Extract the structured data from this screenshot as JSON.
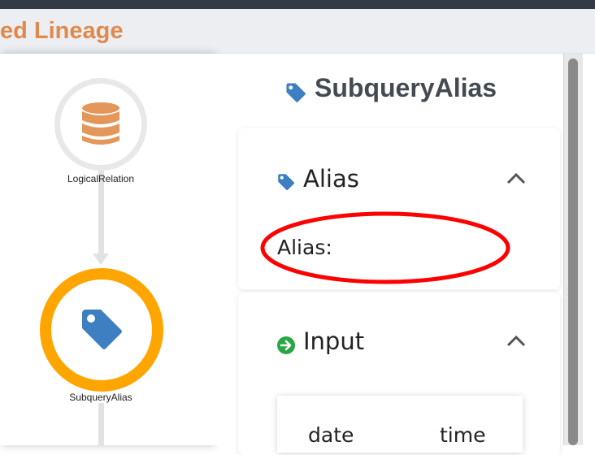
{
  "window": {
    "title": "ed Lineage"
  },
  "graph": {
    "nodes": [
      {
        "label": "LogicalRelation",
        "icon": "database-icon",
        "color": "#e3975a"
      },
      {
        "label": "SubqueryAlias",
        "icon": "tag-icon",
        "color": "#3d7fc1",
        "selected": true,
        "ring_color": "#ffa500"
      }
    ]
  },
  "detail": {
    "header": "SubqueryAlias",
    "header_icon": "tag-icon",
    "sections": [
      {
        "title": "Alias",
        "icon": "tag-icon",
        "expanded": true,
        "fields": [
          {
            "label": "Alias:",
            "value": ""
          }
        ]
      },
      {
        "title": "Input",
        "icon": "arrow-circle-right-icon",
        "expanded": true,
        "table": {
          "columns": [
            "date",
            "time"
          ]
        }
      }
    ]
  },
  "colors": {
    "accent": "#e0894a",
    "tag": "#3d7fc1",
    "annotation": "#ff0000",
    "input_icon": "#28a745"
  }
}
